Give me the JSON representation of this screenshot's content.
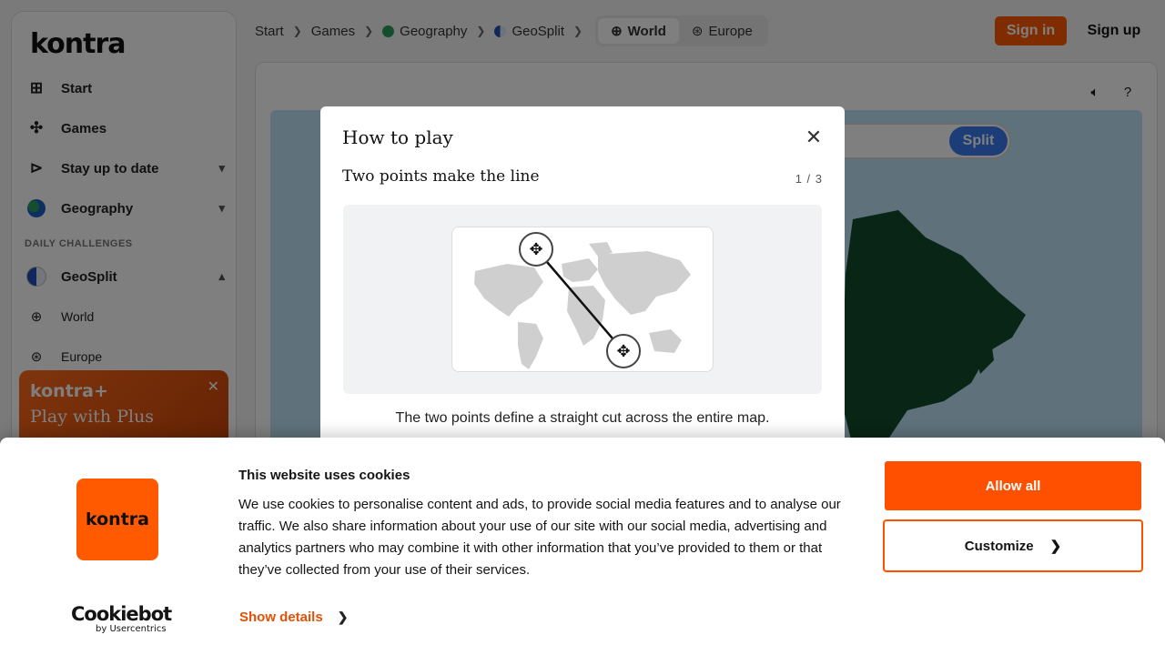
{
  "brand": {
    "logo_text": "kontra"
  },
  "sidebar": {
    "items": [
      {
        "label": "Start",
        "icon": "grid-icon"
      },
      {
        "label": "Games",
        "icon": "puzzle-icon"
      },
      {
        "label": "Stay up to date",
        "icon": "megaphone-icon"
      },
      {
        "label": "Geography",
        "icon": "globe-icon"
      }
    ],
    "section_label": "DAILY CHALLENGES",
    "challenge": {
      "label": "GeoSplit",
      "icon": "half-circle-icon"
    },
    "sub_items": [
      {
        "label": "World",
        "icon": "world-icon"
      },
      {
        "label": "Europe",
        "icon": "europe-icon"
      }
    ],
    "plus_card": {
      "logo": "kontra+",
      "text": "Play with Plus"
    }
  },
  "breadcrumb": {
    "items": [
      "Start",
      "Games",
      "Geography",
      "GeoSplit"
    ],
    "pills": [
      {
        "label": "World",
        "active": true
      },
      {
        "label": "Europe",
        "active": false
      }
    ]
  },
  "header": {
    "sign_in": "Sign in",
    "sign_up": "Sign up"
  },
  "game": {
    "split_label": "Split"
  },
  "modal": {
    "title": "How to play",
    "subtitle": "Two points make the line",
    "step": "1 / 3",
    "description": "The two points define a straight cut across the entire map."
  },
  "cookie": {
    "logo_text": "kontra",
    "title": "This website uses cookies",
    "body": "We use cookies to personalise content and ads, to provide social media features and to analyse our traffic. We also share information about your use of our site with our social media, advertising and analytics partners who may combine it with other information that you’ve provided to them or that they’ve collected from your use of their services.",
    "show_details": "Show details",
    "allow_all": "Allow all",
    "customize": "Customize",
    "provider": "Cookiebot",
    "provider_sub": "by Usercentrics"
  },
  "colors": {
    "accent": "#ff5a00",
    "split_button": "#3a7bf0",
    "map_ocean": "#bfe3f5",
    "map_land": "#114a2a"
  }
}
